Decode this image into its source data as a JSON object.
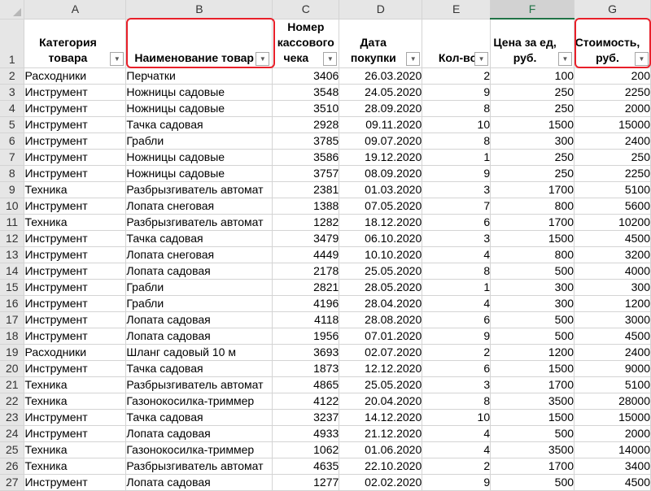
{
  "columns": [
    "A",
    "B",
    "C",
    "D",
    "E",
    "F",
    "G"
  ],
  "header": {
    "row_number": "1",
    "a": [
      "Категория",
      "товара"
    ],
    "b": [
      "Наименование товар"
    ],
    "c": [
      "Номер",
      "кассового",
      "чека"
    ],
    "d": [
      "Дата",
      "покупки"
    ],
    "e": [
      "Кол-во"
    ],
    "f": [
      "Цена за ед,",
      "руб."
    ],
    "g": [
      "Стоимость,",
      "руб."
    ]
  },
  "filter_glyph": "▼",
  "highlight_color": "#e8202a",
  "selected_column_color": "#217346",
  "rows": [
    {
      "n": "2",
      "a": "Расходники",
      "b": "Перчатки",
      "c": "3406",
      "d": "26.03.2020",
      "e": "2",
      "f": "100",
      "g": "200"
    },
    {
      "n": "3",
      "a": "Инструмент",
      "b": "Ножницы садовые",
      "c": "3548",
      "d": "24.05.2020",
      "e": "9",
      "f": "250",
      "g": "2250"
    },
    {
      "n": "4",
      "a": "Инструмент",
      "b": "Ножницы садовые",
      "c": "3510",
      "d": "28.09.2020",
      "e": "8",
      "f": "250",
      "g": "2000"
    },
    {
      "n": "5",
      "a": "Инструмент",
      "b": "Тачка садовая",
      "c": "2928",
      "d": "09.11.2020",
      "e": "10",
      "f": "1500",
      "g": "15000"
    },
    {
      "n": "6",
      "a": "Инструмент",
      "b": "Грабли",
      "c": "3785",
      "d": "09.07.2020",
      "e": "8",
      "f": "300",
      "g": "2400"
    },
    {
      "n": "7",
      "a": "Инструмент",
      "b": "Ножницы садовые",
      "c": "3586",
      "d": "19.12.2020",
      "e": "1",
      "f": "250",
      "g": "250"
    },
    {
      "n": "8",
      "a": "Инструмент",
      "b": "Ножницы садовые",
      "c": "3757",
      "d": "08.09.2020",
      "e": "9",
      "f": "250",
      "g": "2250"
    },
    {
      "n": "9",
      "a": "Техника",
      "b": "Разбрызгиватель автомат",
      "c": "2381",
      "d": "01.03.2020",
      "e": "3",
      "f": "1700",
      "g": "5100"
    },
    {
      "n": "10",
      "a": "Инструмент",
      "b": "Лопата снеговая",
      "c": "1388",
      "d": "07.05.2020",
      "e": "7",
      "f": "800",
      "g": "5600"
    },
    {
      "n": "11",
      "a": "Техника",
      "b": "Разбрызгиватель автомат",
      "c": "1282",
      "d": "18.12.2020",
      "e": "6",
      "f": "1700",
      "g": "10200"
    },
    {
      "n": "12",
      "a": "Инструмент",
      "b": "Тачка садовая",
      "c": "3479",
      "d": "06.10.2020",
      "e": "3",
      "f": "1500",
      "g": "4500"
    },
    {
      "n": "13",
      "a": "Инструмент",
      "b": "Лопата снеговая",
      "c": "4449",
      "d": "10.10.2020",
      "e": "4",
      "f": "800",
      "g": "3200"
    },
    {
      "n": "14",
      "a": "Инструмент",
      "b": "Лопата садовая",
      "c": "2178",
      "d": "25.05.2020",
      "e": "8",
      "f": "500",
      "g": "4000"
    },
    {
      "n": "15",
      "a": "Инструмент",
      "b": "Грабли",
      "c": "2821",
      "d": "28.05.2020",
      "e": "1",
      "f": "300",
      "g": "300"
    },
    {
      "n": "16",
      "a": "Инструмент",
      "b": "Грабли",
      "c": "4196",
      "d": "28.04.2020",
      "e": "4",
      "f": "300",
      "g": "1200"
    },
    {
      "n": "17",
      "a": "Инструмент",
      "b": "Лопата садовая",
      "c": "4118",
      "d": "28.08.2020",
      "e": "6",
      "f": "500",
      "g": "3000"
    },
    {
      "n": "18",
      "a": "Инструмент",
      "b": "Лопата садовая",
      "c": "1956",
      "d": "07.01.2020",
      "e": "9",
      "f": "500",
      "g": "4500"
    },
    {
      "n": "19",
      "a": "Расходники",
      "b": "Шланг садовый 10 м",
      "c": "3693",
      "d": "02.07.2020",
      "e": "2",
      "f": "1200",
      "g": "2400"
    },
    {
      "n": "20",
      "a": "Инструмент",
      "b": "Тачка садовая",
      "c": "1873",
      "d": "12.12.2020",
      "e": "6",
      "f": "1500",
      "g": "9000"
    },
    {
      "n": "21",
      "a": "Техника",
      "b": "Разбрызгиватель автомат",
      "c": "4865",
      "d": "25.05.2020",
      "e": "3",
      "f": "1700",
      "g": "5100"
    },
    {
      "n": "22",
      "a": "Техника",
      "b": "Газонокосилка-триммер",
      "c": "4122",
      "d": "20.04.2020",
      "e": "8",
      "f": "3500",
      "g": "28000"
    },
    {
      "n": "23",
      "a": "Инструмент",
      "b": "Тачка садовая",
      "c": "3237",
      "d": "14.12.2020",
      "e": "10",
      "f": "1500",
      "g": "15000"
    },
    {
      "n": "24",
      "a": "Инструмент",
      "b": "Лопата садовая",
      "c": "4933",
      "d": "21.12.2020",
      "e": "4",
      "f": "500",
      "g": "2000"
    },
    {
      "n": "25",
      "a": "Техника",
      "b": "Газонокосилка-триммер",
      "c": "1062",
      "d": "01.06.2020",
      "e": "4",
      "f": "3500",
      "g": "14000"
    },
    {
      "n": "26",
      "a": "Техника",
      "b": "Разбрызгиватель автомат",
      "c": "4635",
      "d": "22.10.2020",
      "e": "2",
      "f": "1700",
      "g": "3400"
    },
    {
      "n": "27",
      "a": "Инструмент",
      "b": "Лопата садовая",
      "c": "1277",
      "d": "02.02.2020",
      "e": "9",
      "f": "500",
      "g": "4500"
    }
  ]
}
